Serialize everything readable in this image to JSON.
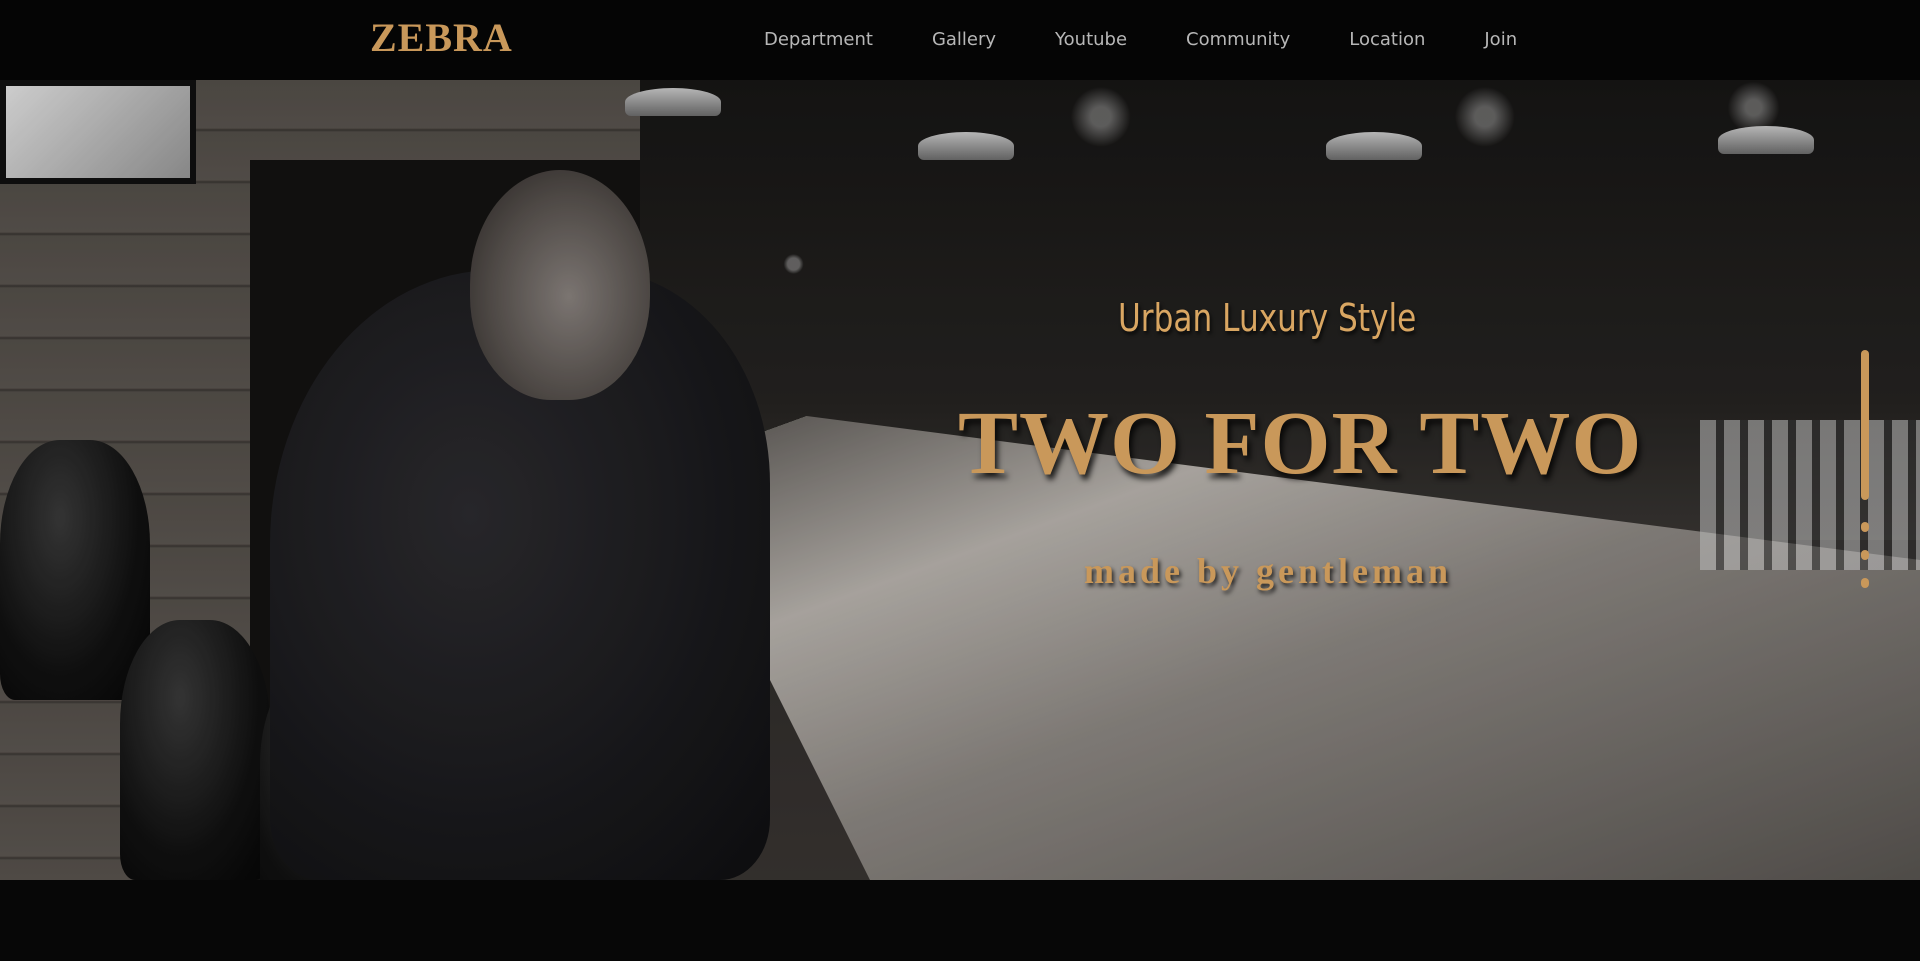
{
  "navbar": {
    "logo": "ZEBRA",
    "items": [
      "Department",
      "Gallery",
      "Youtube",
      "Community",
      "Location",
      "Join"
    ]
  },
  "hero": {
    "subtitle": "Urban Luxury Style",
    "headline": "TWO FOR TWO",
    "tagline": "made by gentleman",
    "slides_total": 4,
    "active_slide": 1
  },
  "colors": {
    "accent": "#c9985a",
    "nav_background": "#050505",
    "nav_text": "#b7b7b7",
    "page_background": "#070707"
  }
}
